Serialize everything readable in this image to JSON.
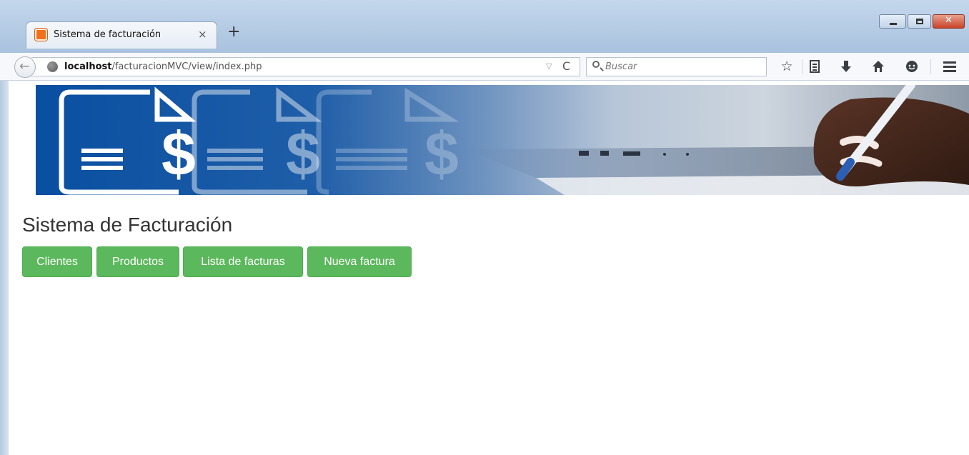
{
  "browser": {
    "tab": {
      "title": "Sistema de facturación",
      "close": "×"
    },
    "new_tab": "+",
    "url": {
      "host": "localhost",
      "path": "/facturacionMVC/view/index.php"
    },
    "search": {
      "placeholder": "Buscar"
    },
    "icons": [
      "back-arrow-icon",
      "globe-icon",
      "dropdown-icon",
      "reload-icon",
      "search-icon",
      "star-icon",
      "reading-list-icon",
      "download-icon",
      "home-icon",
      "chat-icon",
      "menu-icon"
    ]
  },
  "page": {
    "title": "Sistema de Facturación",
    "buttons": [
      {
        "label": "Clientes"
      },
      {
        "label": "Productos"
      },
      {
        "label": "Lista de facturas"
      },
      {
        "label": "Nueva factura"
      }
    ]
  },
  "colors": {
    "button_green": "#5cb85c",
    "banner_blue": "#094fa1"
  }
}
